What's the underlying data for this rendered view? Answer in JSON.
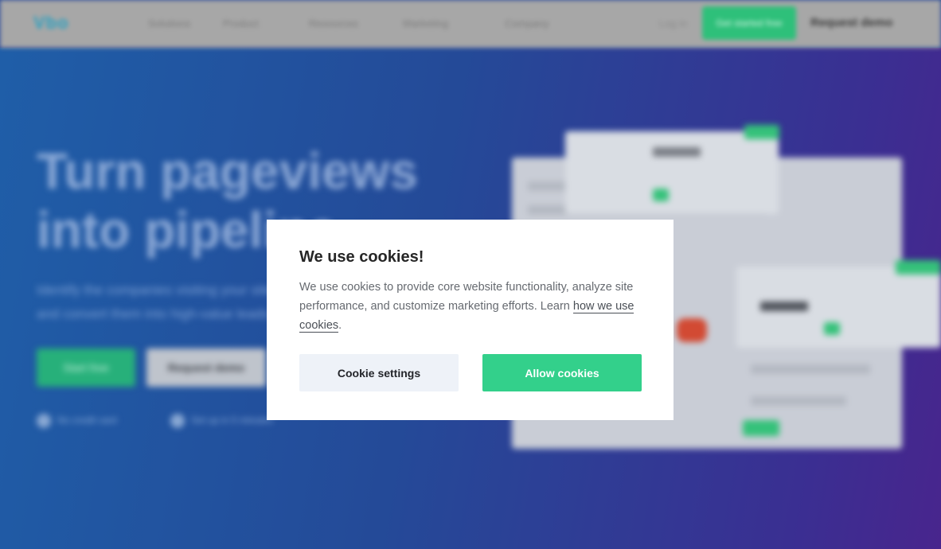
{
  "nav": {
    "logo": "Vbo",
    "items": [
      "Solutions",
      "Product",
      "Resources",
      "Marketing",
      "Company"
    ],
    "login": "Log in",
    "cta": "Get started free",
    "demo": "Request demo",
    "cta_color": "#2ec07a"
  },
  "hero": {
    "headline_line1": "Turn pageviews",
    "headline_line2": "into pipeline",
    "subtext": "Identify the companies visiting your site and convert them into high-value leads",
    "primary_button": "Start free",
    "secondary_button": "Request demo",
    "trust": [
      "No credit card",
      "Set up in 5 minutes"
    ],
    "gradient_start": "#1f5ea8",
    "gradient_end": "#48258d"
  },
  "cookie_modal": {
    "title": "We use cookies!",
    "body": "We use cookies to provide core website functionality, analyze site performance, and customize marketing efforts. Learn",
    "link_text": "how we use cookies",
    "body_end": ".",
    "settings_button": "Cookie settings",
    "allow_button": "Allow cookies",
    "accent_color": "#33d08b"
  }
}
